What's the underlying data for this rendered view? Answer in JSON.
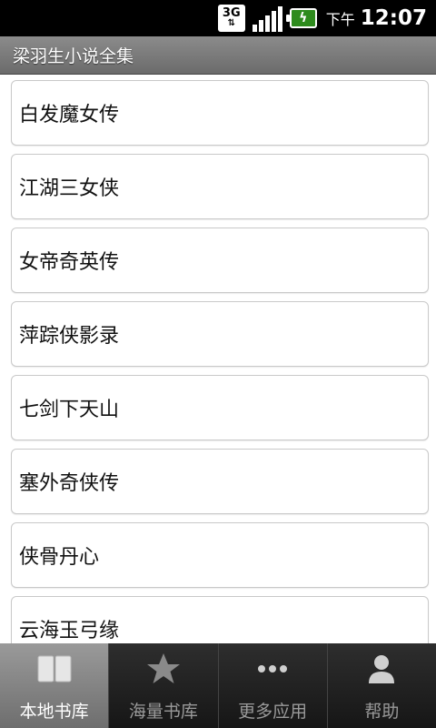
{
  "status_bar": {
    "network": "3G",
    "ampm": "下午",
    "time": "12:07"
  },
  "title_bar": {
    "title": "梁羽生小说全集"
  },
  "books": [
    {
      "title": "白发魔女传"
    },
    {
      "title": "江湖三女侠"
    },
    {
      "title": "女帝奇英传"
    },
    {
      "title": "萍踪侠影录"
    },
    {
      "title": "七剑下天山"
    },
    {
      "title": "塞外奇侠传"
    },
    {
      "title": "侠骨丹心"
    },
    {
      "title": "云海玉弓缘"
    }
  ],
  "tabs": [
    {
      "label": "本地书库",
      "icon": "book-icon",
      "active": true
    },
    {
      "label": "海量书库",
      "icon": "star-icon",
      "active": false
    },
    {
      "label": "更多应用",
      "icon": "more-dots-icon",
      "active": false
    },
    {
      "label": "帮助",
      "icon": "person-icon",
      "active": false
    }
  ],
  "colors": {
    "status_bar_bg": "#000000",
    "title_bar_bg": "#7a7a7a",
    "tab_bar_bg": "#1e1e1e",
    "tab_active_bg": "#8a8a8a",
    "battery_green": "#2e8b1d"
  }
}
